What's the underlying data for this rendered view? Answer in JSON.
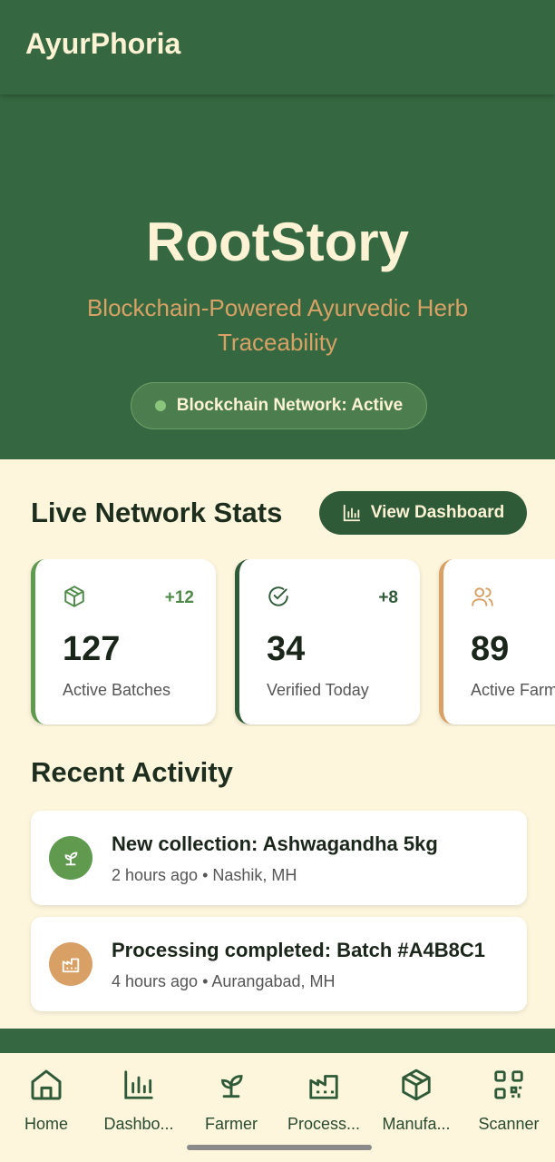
{
  "app_bar": {
    "title": "AyurPhoria"
  },
  "hero": {
    "brand": "RootStory",
    "tagline": "Blockchain-Powered Ayurvedic Herb Traceability",
    "status": "Blockchain Network: Active"
  },
  "stats_section": {
    "title": "Live Network Stats",
    "view_button": "View Dashboard",
    "cards": [
      {
        "icon": "box-icon",
        "delta": "+12",
        "value": "127",
        "label": "Active Batches",
        "accent": "#5f9a4f"
      },
      {
        "icon": "check-circle-icon",
        "delta": "+8",
        "value": "34",
        "label": "Verified Today",
        "accent": "#2f5a38"
      },
      {
        "icon": "users-icon",
        "delta": "",
        "value": "89",
        "label": "Active Farmers",
        "accent": "#d9a066"
      }
    ]
  },
  "activity_section": {
    "title": "Recent Activity",
    "items": [
      {
        "icon": "sprout-icon",
        "title": "New collection: Ashwagandha 5kg",
        "time": "2 hours ago",
        "location": "Nashik, MH",
        "color": "#5f9a4f"
      },
      {
        "icon": "factory-icon",
        "title": "Processing completed: Batch #A4B8C1",
        "time": "4 hours ago",
        "location": "Aurangabad, MH",
        "color": "#d9a066"
      }
    ]
  },
  "bottom_nav": {
    "items": [
      {
        "label": "Home",
        "icon": "home-icon"
      },
      {
        "label": "Dashbo...",
        "icon": "bar-chart-icon"
      },
      {
        "label": "Farmer",
        "icon": "sprout-icon"
      },
      {
        "label": "Process...",
        "icon": "factory-icon"
      },
      {
        "label": "Manufa...",
        "icon": "box-icon"
      },
      {
        "label": "Scanner",
        "icon": "qr-code-icon"
      }
    ]
  },
  "colors": {
    "primary": "#356840",
    "accent": "#d8a166",
    "background": "#fdf6dd"
  }
}
